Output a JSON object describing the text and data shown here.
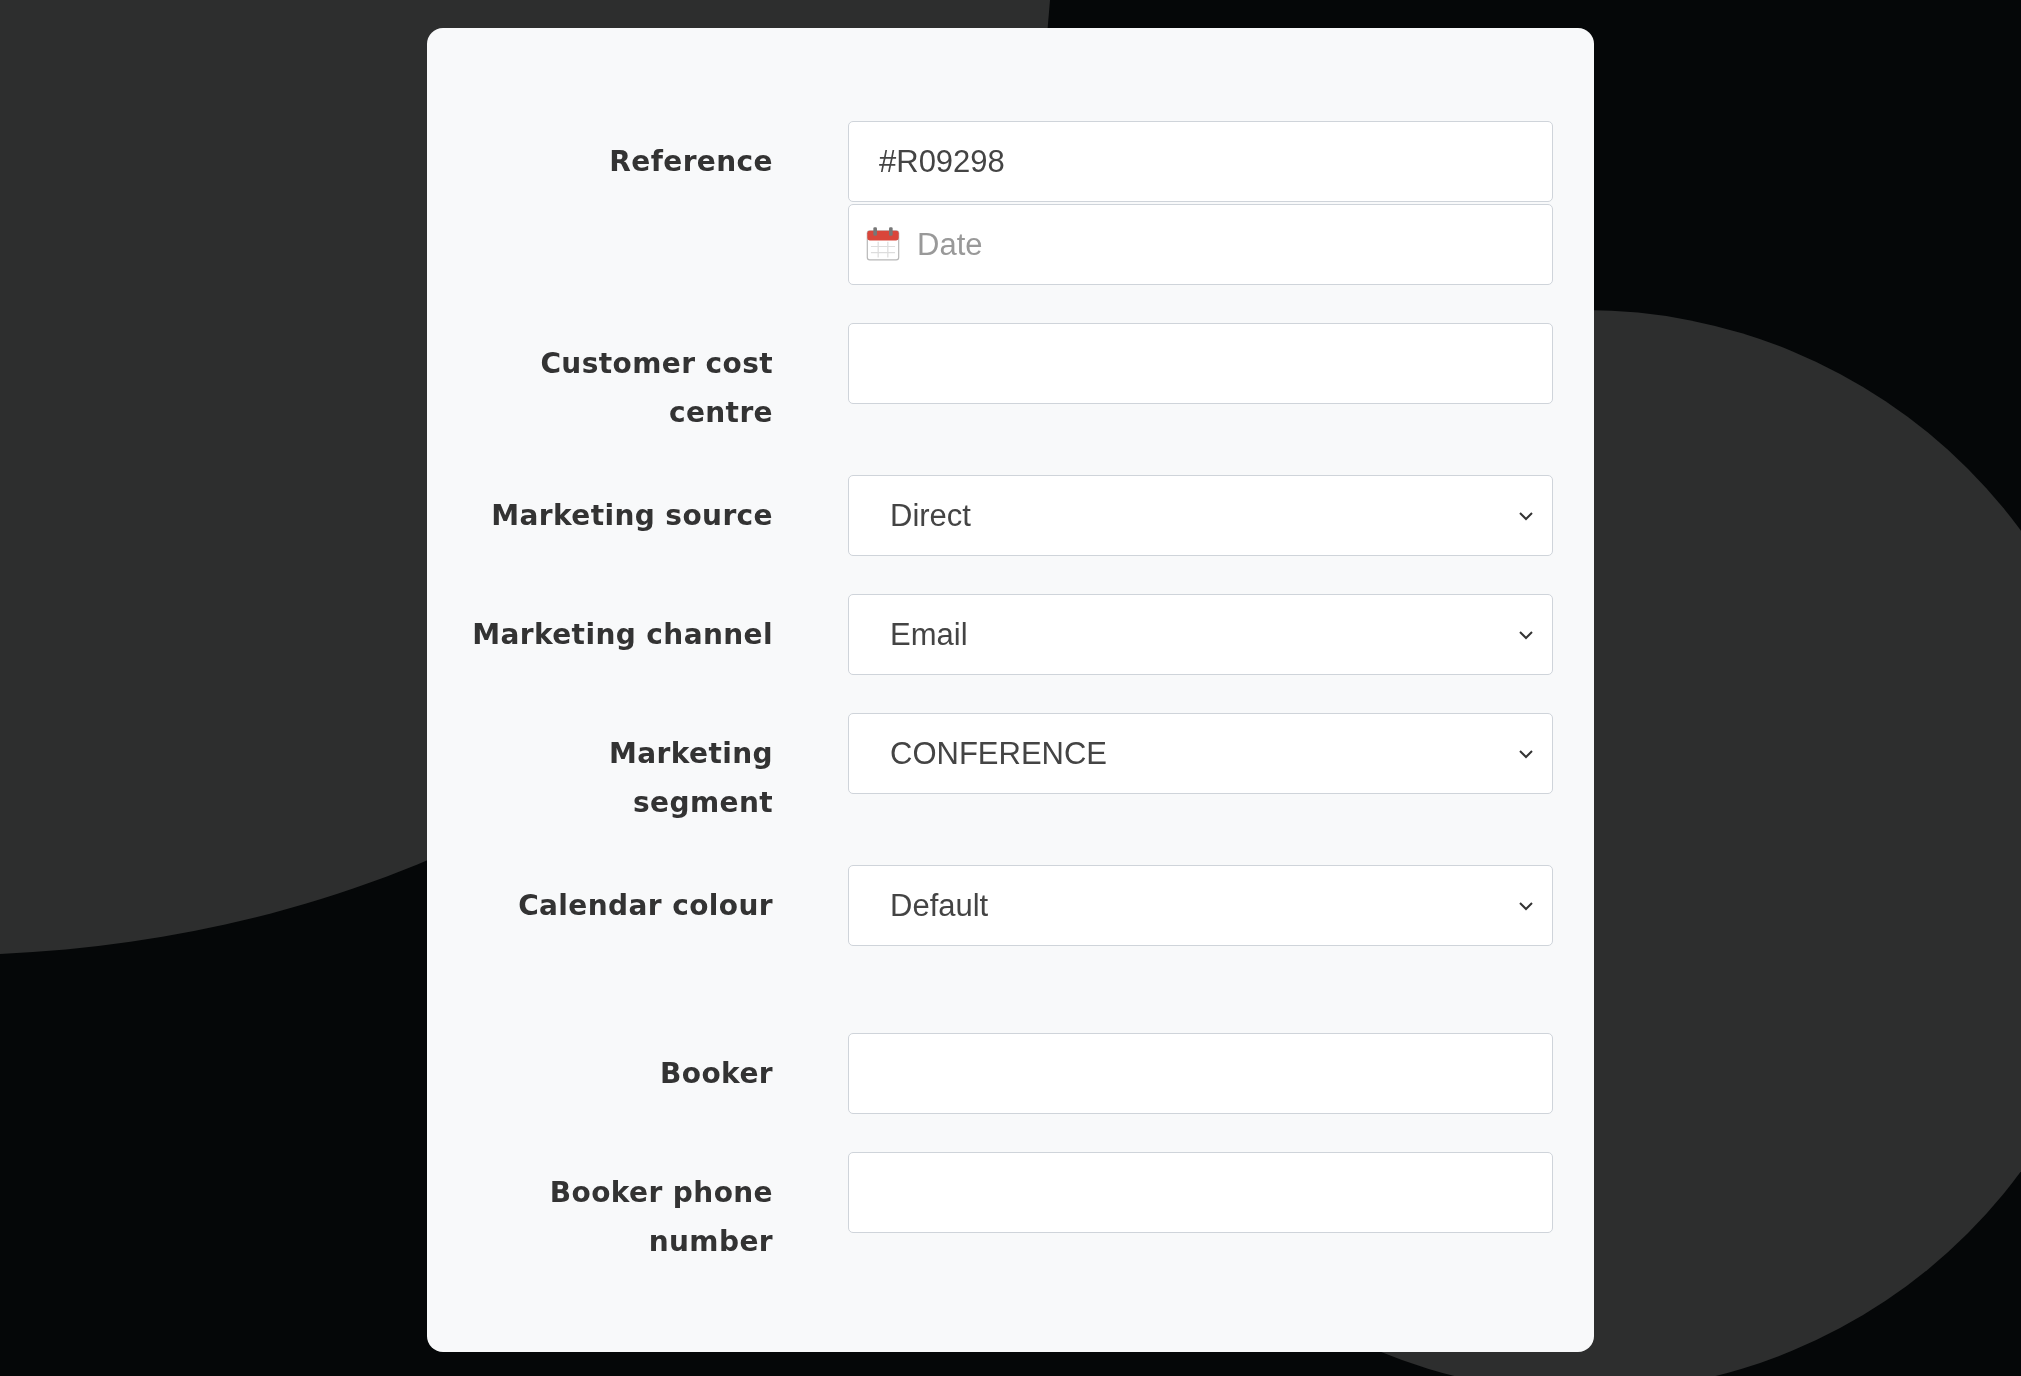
{
  "form": {
    "sections": [
      {
        "rows": [
          {
            "label": "Reference",
            "controls": [
              {
                "kind": "text",
                "value": "#R09298"
              },
              {
                "kind": "date",
                "placeholder": "Date"
              }
            ]
          },
          {
            "label": "Customer cost centre",
            "controls": [
              {
                "kind": "text"
              }
            ]
          },
          {
            "label": "Marketing source",
            "controls": [
              {
                "kind": "select",
                "value": "Direct"
              }
            ]
          },
          {
            "label": "Marketing channel",
            "controls": [
              {
                "kind": "select",
                "value": "Email"
              }
            ]
          },
          {
            "label": "Marketing segment",
            "controls": [
              {
                "kind": "select",
                "value": "CONFERENCE"
              }
            ]
          },
          {
            "label": "Calendar colour",
            "controls": [
              {
                "kind": "select",
                "value": "Default"
              }
            ]
          }
        ]
      },
      {
        "rows": [
          {
            "label": "Booker",
            "controls": [
              {
                "kind": "text"
              }
            ]
          },
          {
            "label": "Booker phone number",
            "controls": [
              {
                "kind": "text"
              }
            ]
          }
        ]
      }
    ]
  }
}
